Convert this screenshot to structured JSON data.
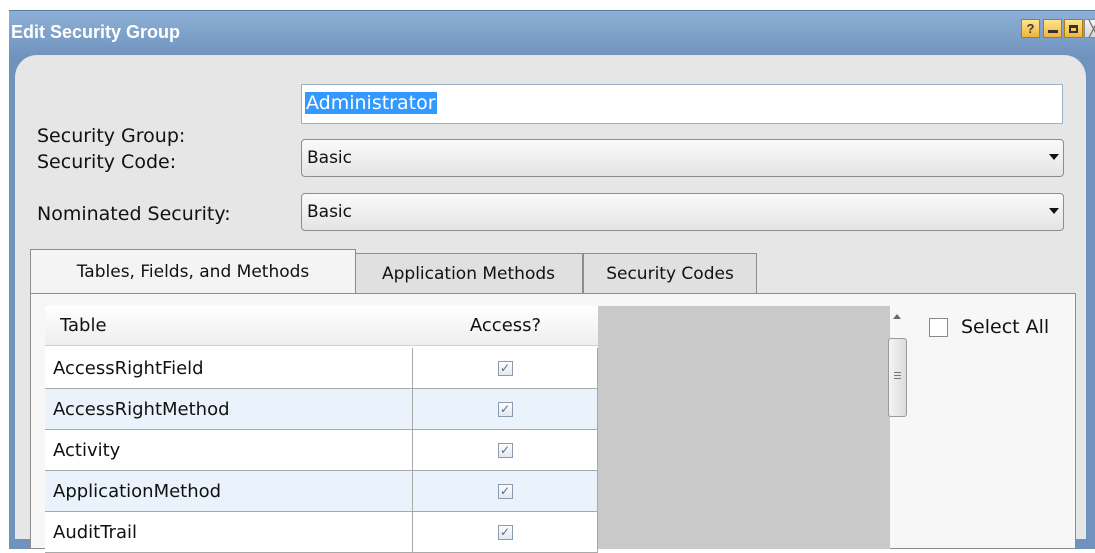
{
  "window": {
    "title": "Edit Security Group",
    "help_glyph": "?",
    "close_glyph": "╳"
  },
  "form": {
    "security_group_label": "Security Group:",
    "security_group_value": "Administrator",
    "security_code_label": "Security Code:",
    "security_code_value": "Basic",
    "nominated_security_label": "Nominated Security:",
    "nominated_security_value": "Basic"
  },
  "tabs": [
    {
      "label": "Tables, Fields, and Methods",
      "active": true
    },
    {
      "label": "Application Methods",
      "active": false
    },
    {
      "label": "Security Codes",
      "active": false
    }
  ],
  "grid": {
    "columns": [
      "Table",
      "Access?"
    ],
    "rows": [
      {
        "table": "AccessRightField",
        "access": true
      },
      {
        "table": "AccessRightMethod",
        "access": true
      },
      {
        "table": "Activity",
        "access": true
      },
      {
        "table": "ApplicationMethod",
        "access": true
      },
      {
        "table": "AuditTrail",
        "access": true
      }
    ]
  },
  "select_all": {
    "label": "Select All",
    "checked": false
  },
  "colors": {
    "titlebar": "#7e9fc4",
    "selection": "#3399ff",
    "panel": "#e6e6e6",
    "alt_row": "#eaf2fb"
  }
}
